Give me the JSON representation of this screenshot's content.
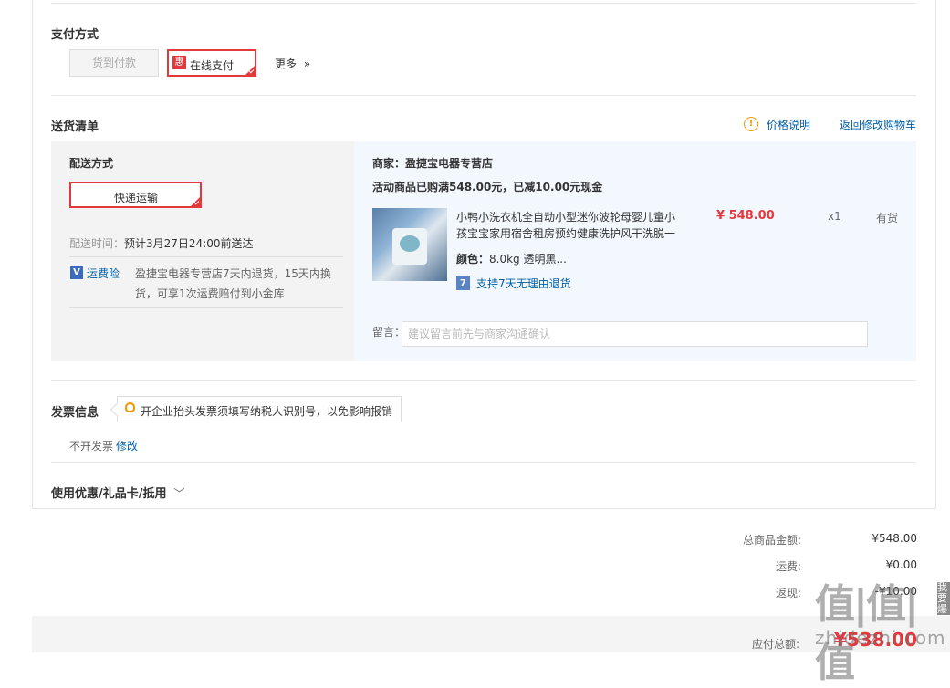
{
  "payment": {
    "title": "支付方式",
    "cod_label": "货到付款",
    "hui_badge": "惠",
    "online_label": "在线支付",
    "more_label": "更多",
    "more_arrow": "»"
  },
  "delivery": {
    "title": "送货清单",
    "price_note_icon": "!",
    "price_note": "价格说明",
    "back_to_cart": "返回修改购物车",
    "shipping_method_title": "配送方式",
    "shipping_method": "快递运输",
    "delivery_time_label": "配送时间：",
    "delivery_time_value": "预计3月27日24:00前送达",
    "insurance_icon": "V",
    "insurance_label": "运费险",
    "insurance_line1": "盈捷宝电器专营店7天内退货，15天内换",
    "insurance_line2": "货，可享1次运费赔付到小金库"
  },
  "shop": {
    "merchant": "商家：盈捷宝电器专营店",
    "promo": "活动商品已购满548.00元，已减10.00元现金",
    "product_name_line1": "小鸭小洗衣机全自动小型迷你波轮母婴儿童小",
    "product_name_line2": "孩宝宝家用宿舍租房预约健康洗护风干洗脱一",
    "color_label": "颜色：",
    "color_value": "8.0kg 透明黑...",
    "return_icon": "7",
    "return_policy": "支持7天无理由退货",
    "price": "¥ 548.00",
    "qty": "x1",
    "stock": "有货",
    "message_label": "留言：",
    "message_placeholder": "建议留言前先与商家沟通确认"
  },
  "invoice": {
    "title": "发票信息",
    "tip": "开企业抬头发票须填写纳税人识别号，以免影响报销",
    "status": "不开发票",
    "edit": "修改"
  },
  "coupon": {
    "title": "使用优惠/礼品卡/抵用",
    "chevron": "﹀"
  },
  "summary": {
    "goods_label": "总商品金额:",
    "goods_value": "¥548.00",
    "freight_label": "运费:",
    "freight_value": "¥0.00",
    "rebate_label": "返现:",
    "rebate_value": "-¥10.00",
    "total_label": "应付总额:",
    "total_value": "¥538.00"
  },
  "watermark": {
    "logo": "值|值|值",
    "site": "zhidezhi.com",
    "side": "我要爆"
  },
  "colors": {
    "accent": "#e4393c",
    "link": "#005ea7",
    "tip_icon": "#f39800"
  }
}
